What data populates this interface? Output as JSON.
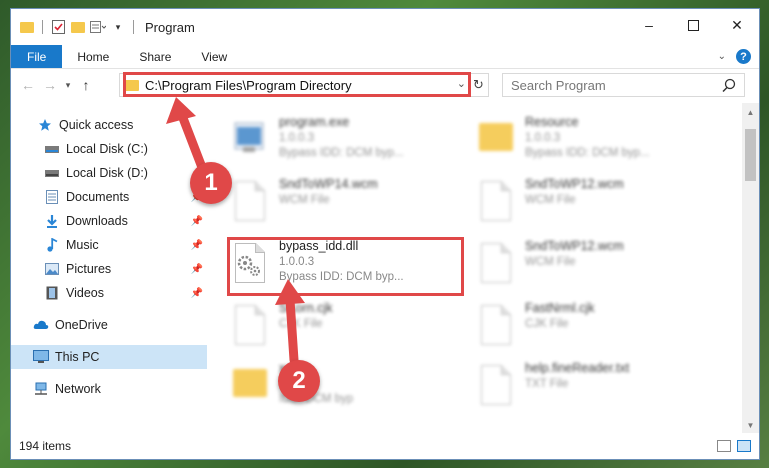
{
  "window": {
    "title": "Program"
  },
  "ribbon": {
    "tabs": [
      "File",
      "Home",
      "Share",
      "View"
    ],
    "help": "?"
  },
  "address": {
    "path": "C:\\Program Files\\Program Directory",
    "search_placeholder": "Search Program"
  },
  "nav": {
    "quick_access": "Quick access",
    "items": [
      {
        "label": "Local Disk (C:)",
        "icon": "drive-icon"
      },
      {
        "label": "Local Disk (D:)",
        "icon": "drive-icon"
      },
      {
        "label": "Documents",
        "icon": "documents-icon"
      },
      {
        "label": "Downloads",
        "icon": "downloads-icon"
      },
      {
        "label": "Music",
        "icon": "music-icon"
      },
      {
        "label": "Pictures",
        "icon": "pictures-icon"
      },
      {
        "label": "Videos",
        "icon": "videos-icon"
      }
    ],
    "onedrive": "OneDrive",
    "thispc": "This PC",
    "network": "Network"
  },
  "files": [
    {
      "name": "program.exe",
      "meta1": "1.0.0.3",
      "meta2": "Bypass IDD: DCM byp...",
      "kind": "exe"
    },
    {
      "name": "Resource",
      "meta1": "1.0.0.3",
      "meta2": "Bypass IDD: DCM byp...",
      "kind": "folder"
    },
    {
      "name": "SndToWP14.wcm",
      "meta1": "WCM File",
      "meta2": "",
      "kind": "file"
    },
    {
      "name": "SndToWP12.wcm",
      "meta1": "WCM File",
      "meta2": "",
      "kind": "file"
    },
    {
      "name": "bypass_idd.dll",
      "meta1": "1.0.0.3",
      "meta2": "Bypass IDD: DCM byp...",
      "kind": "dll"
    },
    {
      "name": "SndToWP12.wcm",
      "meta1": "WCM File",
      "meta2": "",
      "kind": "file"
    },
    {
      "name": "SKorn.cjk",
      "meta1": "CJK File",
      "meta2": "",
      "kind": "file"
    },
    {
      "name": "FastNrml.cjk",
      "meta1": "CJK File",
      "meta2": "",
      "kind": "file"
    },
    {
      "name": "x",
      "meta1": "1.0.0.3",
      "meta2": "IDD: DCM byp",
      "kind": "folder"
    },
    {
      "name": "help.fineReader.txt",
      "meta1": "TXT File",
      "meta2": "",
      "kind": "file"
    }
  ],
  "status": {
    "count": "194 items"
  },
  "callouts": [
    "1",
    "2"
  ],
  "colors": {
    "accent": "#1979ca",
    "highlight": "#e04848",
    "selected_nav": "#cce4f7"
  }
}
